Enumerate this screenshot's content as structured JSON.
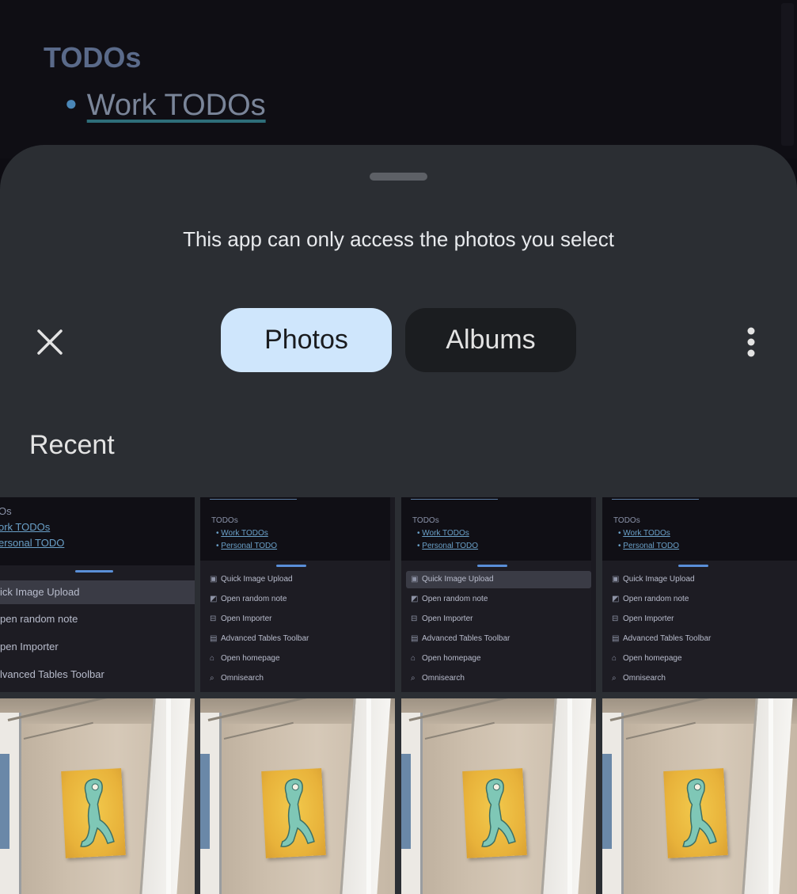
{
  "background_note": {
    "heading": "TODOs",
    "list_item": "Work TODOs"
  },
  "sheet": {
    "message": "This app can only access the photos you select",
    "tabs": {
      "photos": "Photos",
      "albums": "Albums"
    },
    "section": "Recent",
    "icons": {
      "close": "close-icon",
      "more": "more-vert-icon"
    }
  },
  "screenshot_thumb": {
    "heading": "TODOs",
    "links": [
      "Work TODOs",
      "Personal TODO"
    ],
    "menu": [
      "Quick Image Upload",
      "Open random note",
      "Open Importer",
      "Advanced Tables Toolbar",
      "Open homepage",
      "Omnisearch"
    ]
  },
  "first_thumb": {
    "heading": "Os",
    "links": [
      "ork TODOs",
      "ersonal TODO"
    ],
    "menu": [
      "ick Image Upload",
      "pen random note",
      "pen Importer",
      "lvanced Tables Toolbar"
    ]
  },
  "colors": {
    "sheet": "#2b2e33",
    "tab_selected": "#cfe6fc",
    "tab_unselected": "#1b1d20",
    "accent": "#5a8fd8"
  }
}
